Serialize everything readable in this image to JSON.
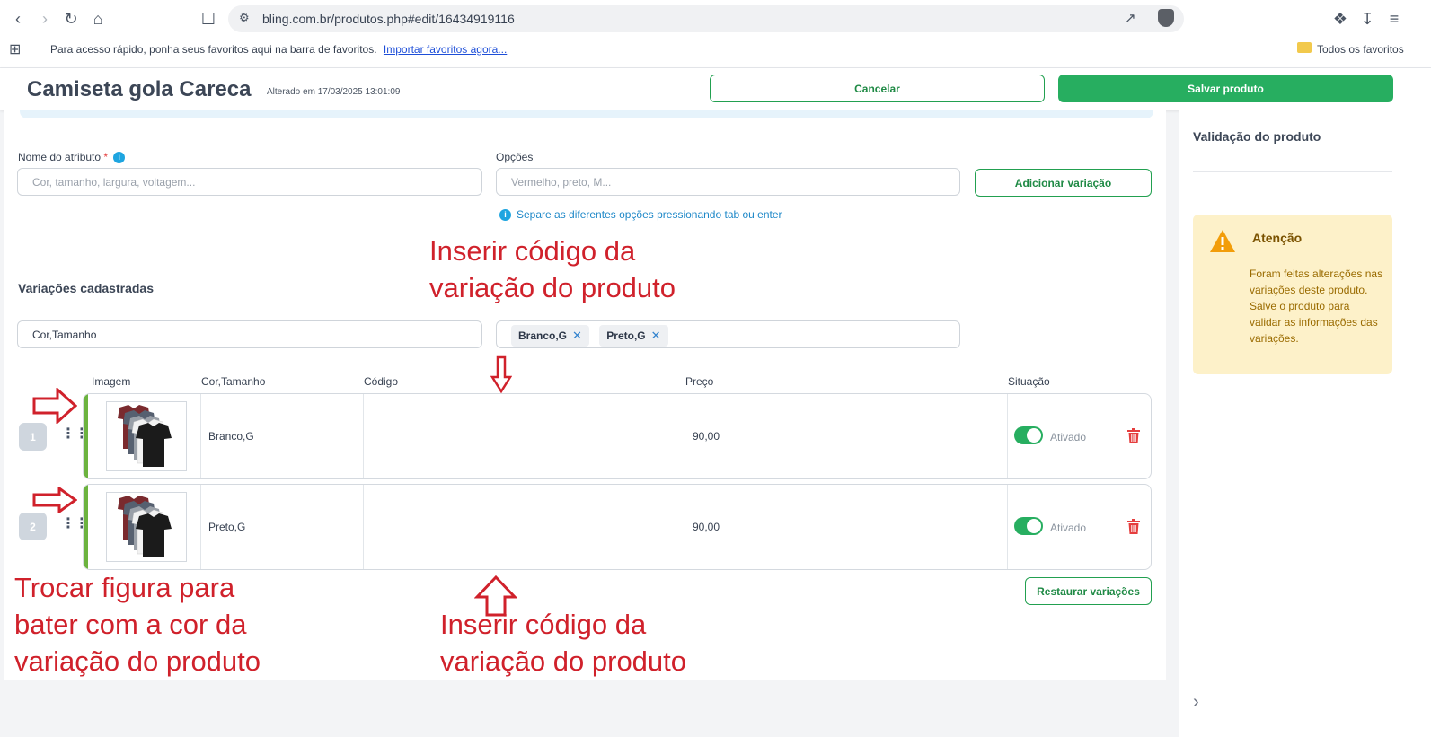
{
  "browser": {
    "url": "bling.com.br/produtos.php#edit/16434919116",
    "bookmarks_text": "Para acesso rápido, ponha seus favoritos aqui na barra de favoritos.",
    "bookmarks_link": "Importar favoritos agora...",
    "all_bookmarks": "Todos os favoritos"
  },
  "header": {
    "title": "Camiseta gola Careca",
    "subtitle": "Alterado em 17/03/2025 13:01:09",
    "cancel_label": "Cancelar",
    "save_label": "Salvar produto"
  },
  "form": {
    "attr_label": "Nome do atributo",
    "attr_required": "*",
    "attr_placeholder": "Cor, tamanho, largura, voltagem...",
    "options_label": "Opções",
    "options_placeholder": "Vermelho, preto, M...",
    "add_variation_label": "Adicionar variação",
    "hint": "Separe as diferentes opções pressionando tab ou enter"
  },
  "variations": {
    "section_title": "Variações cadastradas",
    "attribute_value": "Cor,Tamanho",
    "chips": [
      "Branco,G",
      "Preto,G"
    ],
    "columns": {
      "image": "Imagem",
      "attr": "Cor,Tamanho",
      "code": "Código",
      "price": "Preço",
      "status": "Situação"
    },
    "rows": [
      {
        "num": "1",
        "attr": "Branco,G",
        "code": "",
        "price": "90,00",
        "status": "Ativado",
        "enabled": true
      },
      {
        "num": "2",
        "attr": "Preto,G",
        "code": "",
        "price": "90,00",
        "status": "Ativado",
        "enabled": true
      }
    ],
    "restore_label": "Restaurar variações"
  },
  "annotations": {
    "top": "Inserir código da\nvariação do produto",
    "left": "Trocar figura para\nbater com a cor da\nvariação do produto",
    "bottom": "Inserir código da\nvariação do produto",
    "color": "#d0212b"
  },
  "side": {
    "title": "Validação do produto",
    "alert_title": "Atenção",
    "alert_body_1": "Foram feitas alterações nas variações deste produto.",
    "alert_body_2": "Salve o produto para validar as informações das variações."
  }
}
